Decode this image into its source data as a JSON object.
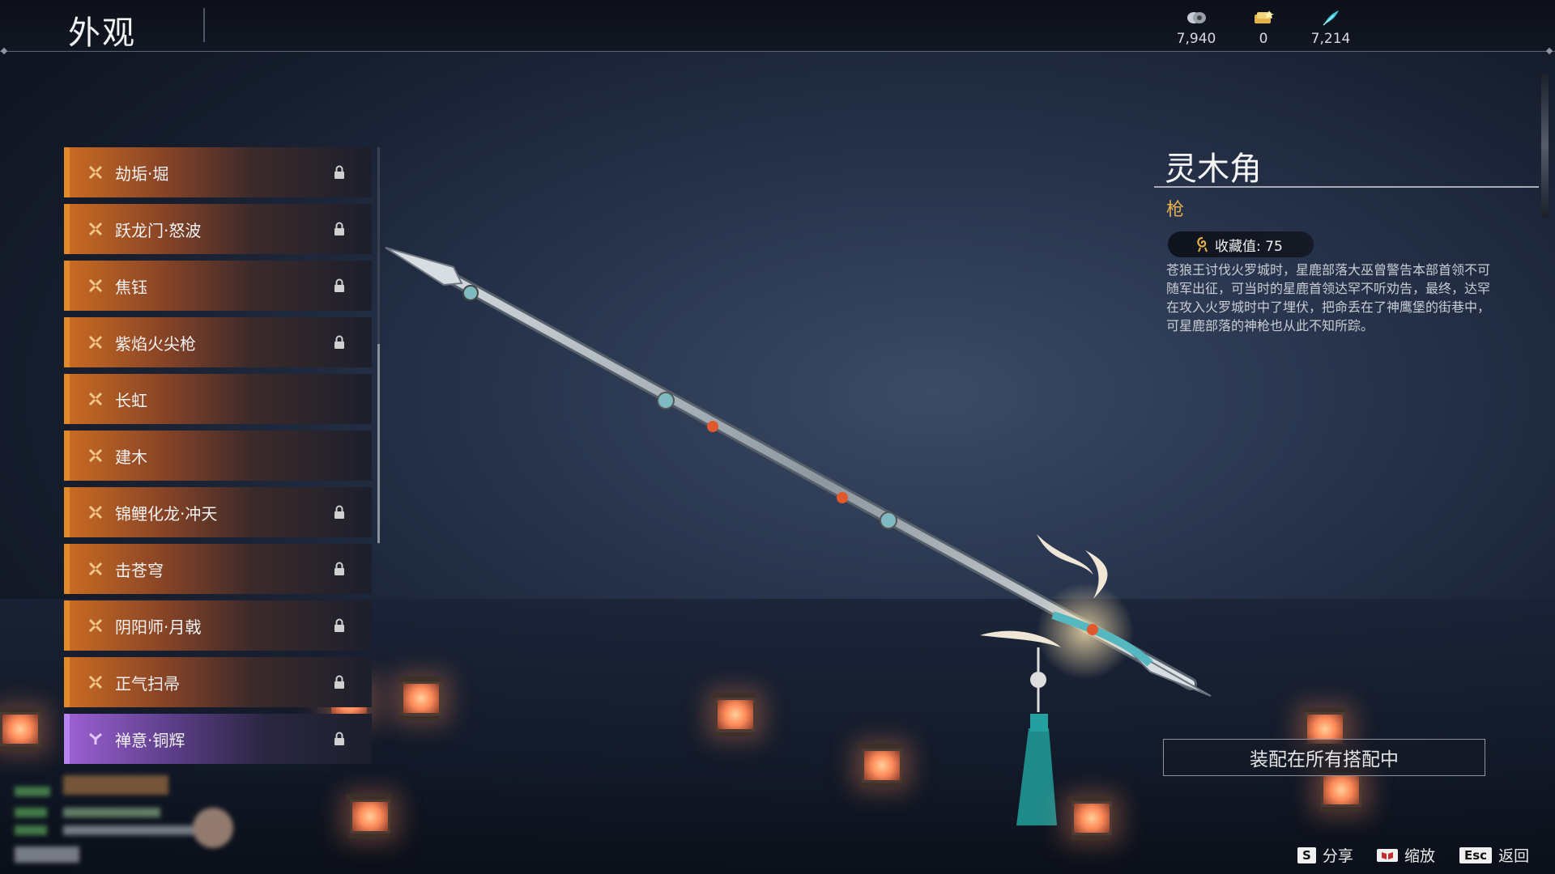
{
  "header": {
    "title": "外观",
    "currencies": [
      {
        "icon": "coin-icon",
        "value": "7,940"
      },
      {
        "icon": "ticket-icon",
        "value": "0"
      },
      {
        "icon": "feather-icon",
        "value": "7,214"
      }
    ]
  },
  "list": {
    "items": [
      {
        "name": "劫垢·堀",
        "locked": true,
        "quality": "orange"
      },
      {
        "name": "跃龙门·怒波",
        "locked": true,
        "quality": "orange"
      },
      {
        "name": "焦钰",
        "locked": true,
        "quality": "orange"
      },
      {
        "name": "紫焰火尖枪",
        "locked": true,
        "quality": "orange"
      },
      {
        "name": "长虹",
        "locked": false,
        "quality": "orange"
      },
      {
        "name": "建木",
        "locked": false,
        "quality": "orange"
      },
      {
        "name": "锦鲤化龙·冲天",
        "locked": true,
        "quality": "orange"
      },
      {
        "name": "击苍穹",
        "locked": true,
        "quality": "orange"
      },
      {
        "name": "阴阳师·月戟",
        "locked": true,
        "quality": "orange"
      },
      {
        "name": "正气扫帚",
        "locked": true,
        "quality": "orange"
      },
      {
        "name": "禅意·铜辉",
        "locked": true,
        "quality": "purple"
      }
    ]
  },
  "detail": {
    "name": "灵木角",
    "type": "枪",
    "collection": "收藏值: 75",
    "description": "苍狼王讨伐火罗城时，星鹿部落大巫曾警告本部首领不可随军出征，可当时的星鹿首领达罕不听劝告，最终，达罕在攻入火罗城时中了埋伏，把命丢在了神鹰堡的街巷中，可星鹿部落的神枪也从此不知所踪。",
    "equip_button": "装配在所有搭配中"
  },
  "hints": [
    {
      "key": "S",
      "label": "分享"
    },
    {
      "key": "book-icon",
      "label": "缩放"
    },
    {
      "key": "Esc",
      "label": "返回"
    }
  ],
  "colors": {
    "accent_orange": "#e08a2a",
    "accent_purple": "#b683ef",
    "type_gold": "#e6b04c"
  }
}
